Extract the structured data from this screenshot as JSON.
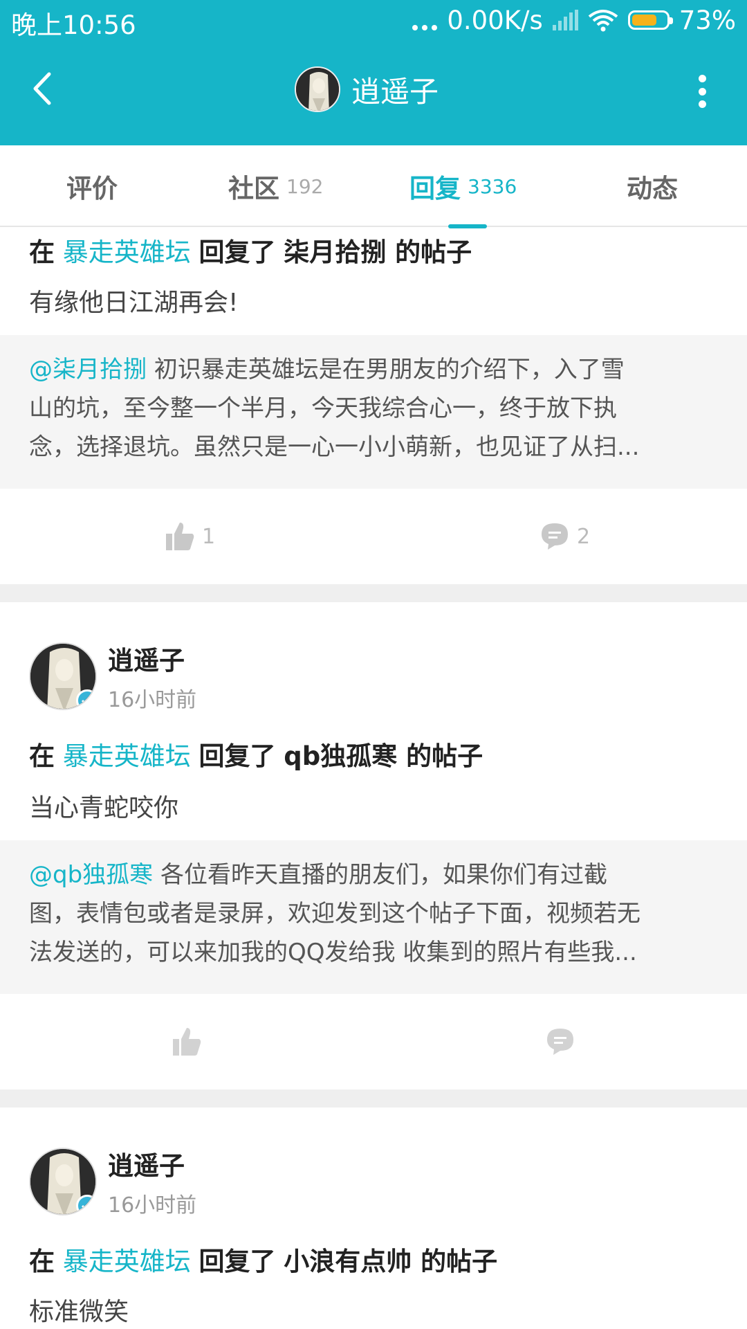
{
  "status_bar": {
    "time": "晚上10:56",
    "network_speed": "0.00K/s",
    "battery": "73%"
  },
  "header": {
    "title": "逍遥子",
    "icons": [
      "back-arrow-icon",
      "avatar",
      "more-vertical-icon"
    ]
  },
  "tabs": [
    {
      "label": "评价",
      "count": ""
    },
    {
      "label": "社区",
      "count": "192"
    },
    {
      "label": "回复",
      "count": "3336",
      "active": true
    },
    {
      "label": "动态",
      "count": ""
    }
  ],
  "posts": [
    {
      "prefix": "在",
      "forum": "暴走英雄坛",
      "action": "回复了",
      "target": "柒月拾捌 的帖子",
      "reply": "有缘他日江湖再会!",
      "quote_mention": "@柒月拾捌",
      "quote_lines": [
        " 初识暴走英雄坛是在男朋友的介绍下，入了雪",
        "山的坑，至今整一个半月，今天我综合心一，终于放下执",
        "念，选择退坑。虽然只是一心一小小萌新，也见证了从扫..."
      ],
      "likes": "1",
      "comments": "2"
    },
    {
      "author": "逍遥子",
      "time": "16小时前",
      "prefix": "在",
      "forum": "暴走英雄坛",
      "action": "回复了",
      "target": "qb独孤寒 的帖子",
      "reply": "当心青蛇咬你",
      "quote_mention": "@qb独孤寒",
      "quote_lines": [
        " 各位看昨天直播的朋友们，如果你们有过截",
        "图，表情包或者是录屏，欢迎发到这个帖子下面，视频若无",
        "法发送的，可以来加我的QQ发给我 收集到的照片有些我..."
      ],
      "likes": "",
      "comments": ""
    },
    {
      "author": "逍遥子",
      "time": "16小时前",
      "prefix": "在",
      "forum": "暴走英雄坛",
      "action": "回复了",
      "target": "小浪有点帅 的帖子",
      "reply": "标准微笑"
    }
  ],
  "colors": {
    "accent": "#16b5c8",
    "battery": "#f6b21b",
    "verified": "#37b4d8"
  }
}
